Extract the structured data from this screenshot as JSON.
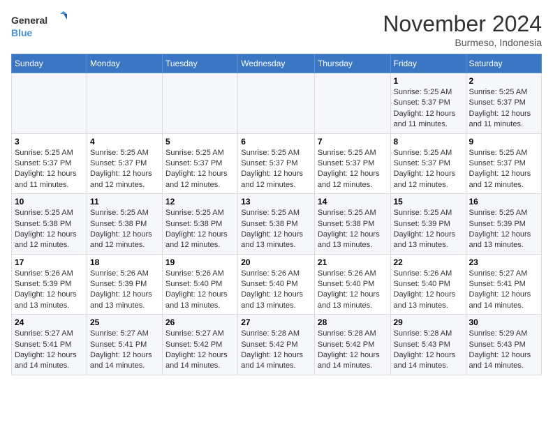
{
  "logo": {
    "line1": "General",
    "line2": "Blue"
  },
  "title": "November 2024",
  "location": "Burmeso, Indonesia",
  "days_of_week": [
    "Sunday",
    "Monday",
    "Tuesday",
    "Wednesday",
    "Thursday",
    "Friday",
    "Saturday"
  ],
  "weeks": [
    [
      {
        "day": "",
        "info": ""
      },
      {
        "day": "",
        "info": ""
      },
      {
        "day": "",
        "info": ""
      },
      {
        "day": "",
        "info": ""
      },
      {
        "day": "",
        "info": ""
      },
      {
        "day": "1",
        "info": "Sunrise: 5:25 AM\nSunset: 5:37 PM\nDaylight: 12 hours and 11 minutes."
      },
      {
        "day": "2",
        "info": "Sunrise: 5:25 AM\nSunset: 5:37 PM\nDaylight: 12 hours and 11 minutes."
      }
    ],
    [
      {
        "day": "3",
        "info": "Sunrise: 5:25 AM\nSunset: 5:37 PM\nDaylight: 12 hours and 11 minutes."
      },
      {
        "day": "4",
        "info": "Sunrise: 5:25 AM\nSunset: 5:37 PM\nDaylight: 12 hours and 12 minutes."
      },
      {
        "day": "5",
        "info": "Sunrise: 5:25 AM\nSunset: 5:37 PM\nDaylight: 12 hours and 12 minutes."
      },
      {
        "day": "6",
        "info": "Sunrise: 5:25 AM\nSunset: 5:37 PM\nDaylight: 12 hours and 12 minutes."
      },
      {
        "day": "7",
        "info": "Sunrise: 5:25 AM\nSunset: 5:37 PM\nDaylight: 12 hours and 12 minutes."
      },
      {
        "day": "8",
        "info": "Sunrise: 5:25 AM\nSunset: 5:37 PM\nDaylight: 12 hours and 12 minutes."
      },
      {
        "day": "9",
        "info": "Sunrise: 5:25 AM\nSunset: 5:37 PM\nDaylight: 12 hours and 12 minutes."
      }
    ],
    [
      {
        "day": "10",
        "info": "Sunrise: 5:25 AM\nSunset: 5:38 PM\nDaylight: 12 hours and 12 minutes."
      },
      {
        "day": "11",
        "info": "Sunrise: 5:25 AM\nSunset: 5:38 PM\nDaylight: 12 hours and 12 minutes."
      },
      {
        "day": "12",
        "info": "Sunrise: 5:25 AM\nSunset: 5:38 PM\nDaylight: 12 hours and 12 minutes."
      },
      {
        "day": "13",
        "info": "Sunrise: 5:25 AM\nSunset: 5:38 PM\nDaylight: 12 hours and 13 minutes."
      },
      {
        "day": "14",
        "info": "Sunrise: 5:25 AM\nSunset: 5:38 PM\nDaylight: 12 hours and 13 minutes."
      },
      {
        "day": "15",
        "info": "Sunrise: 5:25 AM\nSunset: 5:39 PM\nDaylight: 12 hours and 13 minutes."
      },
      {
        "day": "16",
        "info": "Sunrise: 5:25 AM\nSunset: 5:39 PM\nDaylight: 12 hours and 13 minutes."
      }
    ],
    [
      {
        "day": "17",
        "info": "Sunrise: 5:26 AM\nSunset: 5:39 PM\nDaylight: 12 hours and 13 minutes."
      },
      {
        "day": "18",
        "info": "Sunrise: 5:26 AM\nSunset: 5:39 PM\nDaylight: 12 hours and 13 minutes."
      },
      {
        "day": "19",
        "info": "Sunrise: 5:26 AM\nSunset: 5:40 PM\nDaylight: 12 hours and 13 minutes."
      },
      {
        "day": "20",
        "info": "Sunrise: 5:26 AM\nSunset: 5:40 PM\nDaylight: 12 hours and 13 minutes."
      },
      {
        "day": "21",
        "info": "Sunrise: 5:26 AM\nSunset: 5:40 PM\nDaylight: 12 hours and 13 minutes."
      },
      {
        "day": "22",
        "info": "Sunrise: 5:26 AM\nSunset: 5:40 PM\nDaylight: 12 hours and 13 minutes."
      },
      {
        "day": "23",
        "info": "Sunrise: 5:27 AM\nSunset: 5:41 PM\nDaylight: 12 hours and 14 minutes."
      }
    ],
    [
      {
        "day": "24",
        "info": "Sunrise: 5:27 AM\nSunset: 5:41 PM\nDaylight: 12 hours and 14 minutes."
      },
      {
        "day": "25",
        "info": "Sunrise: 5:27 AM\nSunset: 5:41 PM\nDaylight: 12 hours and 14 minutes."
      },
      {
        "day": "26",
        "info": "Sunrise: 5:27 AM\nSunset: 5:42 PM\nDaylight: 12 hours and 14 minutes."
      },
      {
        "day": "27",
        "info": "Sunrise: 5:28 AM\nSunset: 5:42 PM\nDaylight: 12 hours and 14 minutes."
      },
      {
        "day": "28",
        "info": "Sunrise: 5:28 AM\nSunset: 5:42 PM\nDaylight: 12 hours and 14 minutes."
      },
      {
        "day": "29",
        "info": "Sunrise: 5:28 AM\nSunset: 5:43 PM\nDaylight: 12 hours and 14 minutes."
      },
      {
        "day": "30",
        "info": "Sunrise: 5:29 AM\nSunset: 5:43 PM\nDaylight: 12 hours and 14 minutes."
      }
    ]
  ]
}
